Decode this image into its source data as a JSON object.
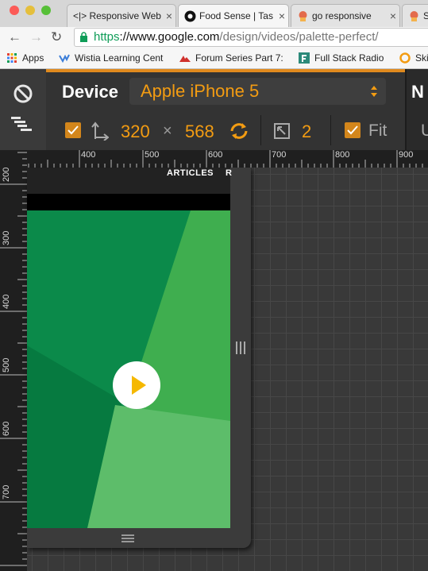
{
  "tabs": [
    {
      "label": "<|> Responsive Web",
      "icon": "code-icon"
    },
    {
      "label": "Food Sense | Tas",
      "icon": "food-sense-icon"
    },
    {
      "label": "go responsive",
      "icon": "go-responsive-icon"
    },
    {
      "label": "Sk",
      "icon": "sk-icon"
    }
  ],
  "address": {
    "https": "https",
    "host": "://www.google.com",
    "path": "/design/videos/palette-perfect/"
  },
  "bookmarks": [
    {
      "label": "Apps",
      "icon": "apps-grid-icon"
    },
    {
      "label": "Wistia Learning Cent",
      "icon": "wistia-icon"
    },
    {
      "label": "Forum Series Part 7:",
      "icon": "forum-icon"
    },
    {
      "label": "Full Stack Radio",
      "icon": "full-stack-radio-icon"
    },
    {
      "label": "Ski",
      "icon": "ski-icon"
    }
  ],
  "device_panel": {
    "device_label": "Device",
    "device_value": "Apple iPhone 5",
    "width": "320",
    "times": "×",
    "height": "568",
    "zoom": "2",
    "fit_label": "Fit",
    "right_n": "N",
    "right_u": "U"
  },
  "rulers": {
    "horizontal": [
      "400",
      "500",
      "600",
      "700",
      "800",
      "900"
    ],
    "vertical": [
      "200",
      "300",
      "400",
      "500",
      "600",
      "700"
    ]
  },
  "page": {
    "nav_articles": "ARTICLES",
    "nav_r": "R"
  },
  "colors": {
    "accent": "#f39c12",
    "green_dark": "#0b8a4a",
    "green_mid": "#3fae4f",
    "green_light": "#5dbd6a"
  }
}
